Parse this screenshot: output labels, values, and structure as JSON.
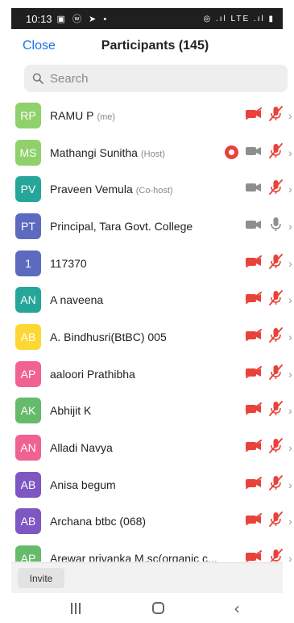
{
  "status_bar": {
    "time": "10:13",
    "left_icons": "▣ ⓦ ➤ •",
    "right_icons": "◎ .ıl LTE .ıl ▮"
  },
  "header": {
    "close_label": "Close",
    "title": "Participants (145)"
  },
  "search": {
    "placeholder": "Search"
  },
  "colors": {
    "accent": "#1a73e8",
    "muted_red": "#e8423a",
    "icon_gray": "#8e8e8e"
  },
  "participants": [
    {
      "initials": "RP",
      "name": "RAMU P",
      "role": "(me)",
      "avatar_color": "#8fd16b",
      "video": "off",
      "audio": "off",
      "recording": false
    },
    {
      "initials": "MS",
      "name": "Mathangi Sunitha",
      "role": "(Host)",
      "avatar_color": "#8fd16b",
      "video": "on",
      "audio": "off",
      "recording": true
    },
    {
      "initials": "PV",
      "name": "Praveen Vemula",
      "role": "(Co-host)",
      "avatar_color": "#26a69a",
      "video": "on",
      "audio": "off",
      "recording": false
    },
    {
      "initials": "PT",
      "name": "Principal, Tara Govt. College",
      "role": "",
      "avatar_color": "#5c6bc0",
      "video": "on",
      "audio": "on",
      "recording": false
    },
    {
      "initials": "1",
      "name": "117370",
      "role": "",
      "avatar_color": "#5c6bc0",
      "video": "off",
      "audio": "off",
      "recording": false
    },
    {
      "initials": "AN",
      "name": "A naveena",
      "role": "",
      "avatar_color": "#26a69a",
      "video": "off",
      "audio": "off",
      "recording": false
    },
    {
      "initials": "AB",
      "name": "A. Bindhusri(BtBC) 005",
      "role": "",
      "avatar_color": "#fdd835",
      "video": "off",
      "audio": "off",
      "recording": false
    },
    {
      "initials": "AP",
      "name": "aaloori Prathibha",
      "role": "",
      "avatar_color": "#f06292",
      "video": "off",
      "audio": "off",
      "recording": false
    },
    {
      "initials": "AK",
      "name": "Abhijit K",
      "role": "",
      "avatar_color": "#66bb6a",
      "video": "off",
      "audio": "off",
      "recording": false
    },
    {
      "initials": "AN",
      "name": "Alladi Navya",
      "role": "",
      "avatar_color": "#f06292",
      "video": "off",
      "audio": "off",
      "recording": false
    },
    {
      "initials": "AB",
      "name": "Anisa begum",
      "role": "",
      "avatar_color": "#7e57c2",
      "video": "off",
      "audio": "off",
      "recording": false
    },
    {
      "initials": "AB",
      "name": "Archana btbc (068)",
      "role": "",
      "avatar_color": "#7e57c2",
      "video": "off",
      "audio": "off",
      "recording": false
    },
    {
      "initials": "AP",
      "name": "Arewar privanka M.sc(organic c...",
      "role": "",
      "avatar_color": "#66bb6a",
      "video": "off",
      "audio": "off",
      "recording": false
    }
  ],
  "footer": {
    "invite_label": "Invite"
  }
}
